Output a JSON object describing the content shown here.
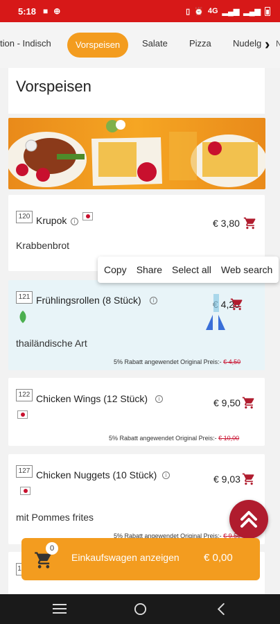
{
  "status_bar": {
    "time": "5:18",
    "network": "4G"
  },
  "tabs": [
    {
      "label": "tion - Indisch"
    },
    {
      "label": "Vorspeisen"
    },
    {
      "label": "Salate"
    },
    {
      "label": "Pizza"
    },
    {
      "label": "Nudelg"
    }
  ],
  "section_title": "Vorspeisen",
  "items": [
    {
      "number": "120",
      "name": "Krupok",
      "price": "€ 3,80",
      "description": "Krabbenbrot"
    },
    {
      "number": "121",
      "name": "Frühlingsrollen (8 Stück)",
      "price": "€ 4,28",
      "description": "thailändische Art",
      "discount_text": "5% Rabatt angewendet Original Preis:-",
      "original_price": "€ 4,50"
    },
    {
      "number": "122",
      "name": "Chicken Wings (12 Stück)",
      "price": "€ 9,50",
      "discount_text": "5% Rabatt angewendet Original Preis:-",
      "original_price": "€ 10,00"
    },
    {
      "number": "127",
      "name": "Chicken Nuggets (10 Stück)",
      "price": "€ 9,03",
      "description": "mit Pommes frites",
      "discount_text": "5% Rabatt angewendet Original Preis:-",
      "original_price": "€ 9,50"
    },
    {
      "number": "1"
    }
  ],
  "context_menu": {
    "copy": "Copy",
    "share": "Share",
    "select_all": "Select all",
    "web_search": "Web search"
  },
  "cart": {
    "count": "0",
    "label": "Einkaufswagen anzeigen",
    "total": "€ 0,00"
  },
  "colors": {
    "status_bar": "#d71818",
    "accent": "#f39c1f",
    "fab": "#b01c2e",
    "cart_icon": "#b01c2e",
    "highlight": "#e8f4f8"
  }
}
